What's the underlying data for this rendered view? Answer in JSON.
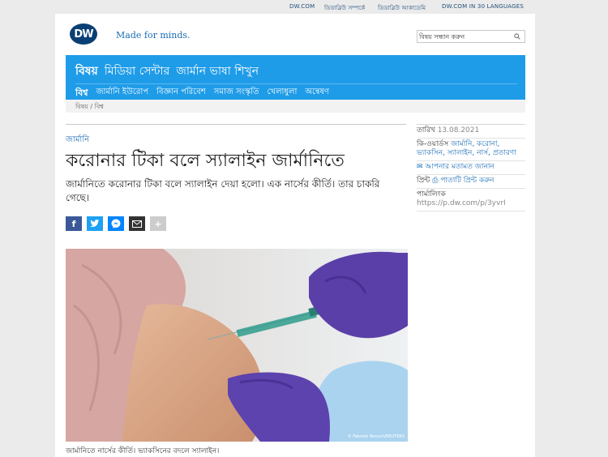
{
  "topbar": {
    "links": [
      "DW.COM",
      "ডিডাব্লিউ সম্পর্কে",
      "ডিডাব্লিউ আকাডেমি",
      "DW.COM IN 30 LANGUAGES"
    ]
  },
  "header": {
    "logo_text": "DW",
    "tagline": "Made for minds.",
    "search_placeholder": "বিষয় সন্ধান করুন"
  },
  "nav": {
    "main": [
      "বিষয়",
      "মিডিয়া সেন্টার",
      "জার্মান ভাষা শিখুন"
    ],
    "sub": [
      "বিশ্ব",
      "জার্মানি ইউরোপ",
      "বিজ্ঞান পরিবেশ",
      "সমাজ সংস্কৃতি",
      "খেলাধুলা",
      "অন্বেষণ"
    ]
  },
  "breadcrumb": "বিষয় / বিশ্ব",
  "article": {
    "kicker": "জার্মানি",
    "headline": "করোনার টিকা বলে স্যালাইন জার্মানিতে",
    "intro": "জার্মানিতে করোনার টিকা বলে স্যালাইন দেয়া হলো। এক নার্সের কীর্তি। তার চাকরি গেছে।",
    "photo_credit": "© Fabrizio Bensch/REUTERS",
    "caption": "জার্মানিতে নার্সের কীর্তি। ভ্যাকসিনের বদলে স্যালাইন।"
  },
  "share": {
    "icons": [
      "facebook-icon",
      "twitter-icon",
      "messenger-icon",
      "mail-icon",
      "plus-icon"
    ],
    "colors": [
      "#3b5998",
      "#1da1f2",
      "#0084ff",
      "#333333",
      "#cccccc"
    ]
  },
  "sidebar": {
    "date_label": "তারিখ",
    "date_value": "13.08.2021",
    "keywords_label": "কি-ওয়ার্ডস",
    "keywords_value": "জার্মানি, করোনা, ভ্যাকসিন, স্যালাইন, নার্স, প্রতারণা",
    "feedback": "আপনার মতামত জানান",
    "print_label": "প্রিন্ট",
    "print_value": "পাতাটি প্রিন্ট করুন",
    "permalink_label": "পার্মালিংক",
    "permalink_value": "https://p.dw.com/p/3yvrI"
  },
  "colors": {
    "nav_blue": "#1f9ce8",
    "link_blue": "#1b6cb5",
    "logo_navy": "#0a3f73"
  }
}
